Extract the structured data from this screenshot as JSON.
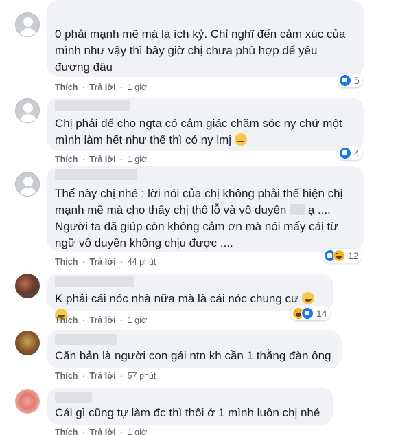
{
  "actions": {
    "like": "Thích",
    "reply": "Trả lời",
    "dot": "·"
  },
  "comments": [
    {
      "text": "0 phải mạnh mẽ mà là ích kỷ. Chỉ nghĩ đến cảm xúc của mình như vậy thì bây giờ chị chưa phù hợp để yêu đương đâu",
      "time": "1 giờ",
      "reactions": [
        "like"
      ],
      "count": "5"
    },
    {
      "text": "Chị phải để cho ngta có cảm giác chăm sóc ny chứ một mình làm hết như thế thì có ny lmj",
      "emoji": "😓",
      "time": "1 giờ",
      "reactions": [
        "like"
      ],
      "count": "4"
    },
    {
      "text1": "Thế này chị nhé : lời nói của chị không phải thể hiện chị mạnh mẽ mà cho thấy chị thô lỗ và vô duyên",
      "text2": "ạ .... Người ta đã giúp còn không cảm ơn mà nói mấy cái từ ngữ vô duyên không chịu được ....",
      "time": "44 phút",
      "reactions": [
        "like",
        "haha"
      ],
      "count": "12"
    },
    {
      "text": "K phải cái nóc nhà nữa mà là cái nóc chung cư",
      "emoji": "😂😂",
      "time": "1 giờ",
      "reactions": [
        "haha",
        "like"
      ],
      "count": "14"
    },
    {
      "text": "Căn bản là người con gái ntn kh cần 1 thằng đàn ông",
      "time": "57 phút"
    },
    {
      "text": "Cái gì cũng tự làm đc thì thôi ở 1 mình luôn chị nhé",
      "time": "1 giờ"
    }
  ]
}
